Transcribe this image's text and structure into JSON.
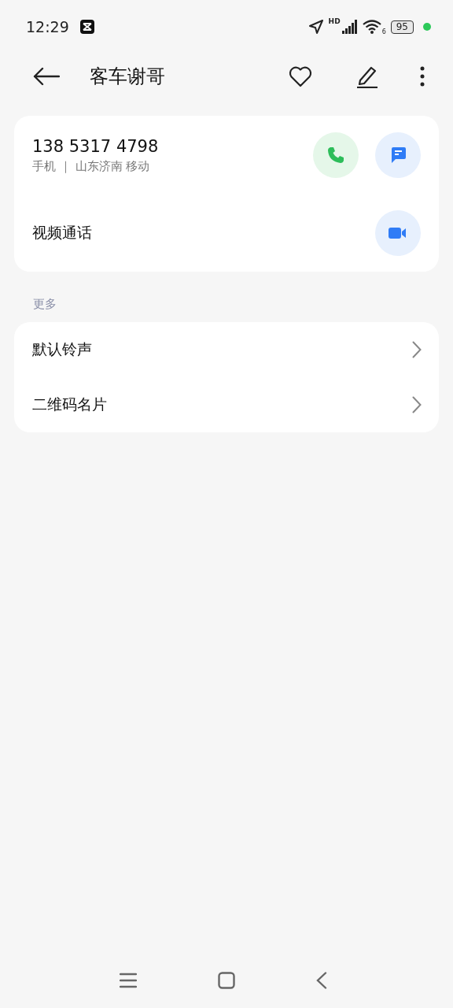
{
  "status_bar": {
    "time": "12:29",
    "network": "HD",
    "wifi_badge": "6",
    "battery": "95"
  },
  "header": {
    "title": "客车谢哥"
  },
  "contact_card": {
    "number": "138 5317 4798",
    "detail": "手机 ｜ 山东济南 移动",
    "video_call": "视频通话"
  },
  "more": {
    "heading": "更多",
    "items": [
      {
        "label": "默认铃声"
      },
      {
        "label": "二维码名片"
      }
    ]
  }
}
